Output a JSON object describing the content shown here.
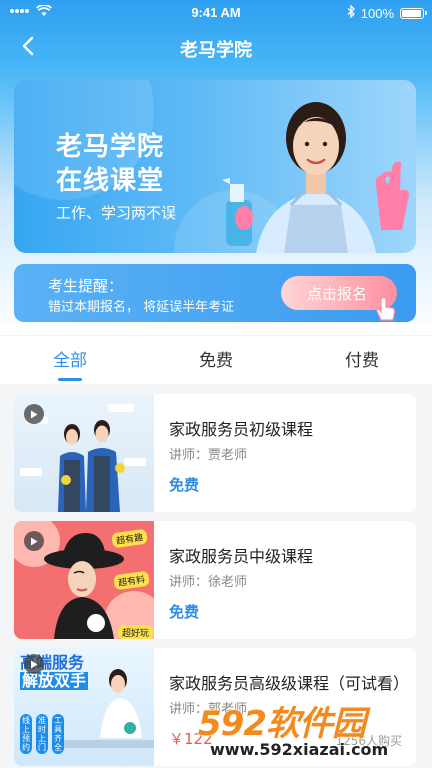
{
  "status_bar": {
    "time": "9:41 AM",
    "battery": "100%"
  },
  "nav": {
    "title": "老马学院"
  },
  "banner": {
    "title_line1": "老马学院",
    "title_line2": "在线课堂",
    "subtitle": "工作、学习两不误"
  },
  "reminder": {
    "title": "考生提醒：",
    "text": "错过本期报名， 将延误半年考证",
    "button": "点击报名"
  },
  "tabs": [
    {
      "label": "全部"
    },
    {
      "label": "免费"
    },
    {
      "label": "付费"
    }
  ],
  "active_tab": "全部",
  "courses": [
    {
      "title": "家政服务员初级课程",
      "teacher": "讲师：贾老师",
      "price": "免费"
    },
    {
      "title": "家政服务员中级课程",
      "teacher": "讲师：徐老师",
      "price": "免费"
    },
    {
      "title": "家政服务员高级级课程（可试看）",
      "teacher": "讲师：郭老师",
      "price": "￥122",
      "count": "1256人购买"
    }
  ],
  "thumb_texts": {
    "card2_bubble1": "超有趣",
    "card2_bubble2": "超有料",
    "card2_bubble3": "超好玩",
    "card3_title1": "高端服务",
    "card3_title2": "解放双手",
    "card3_tag1": "线上预约",
    "card3_tag2": "准时上门",
    "card3_tag3": "工具齐全"
  },
  "watermark": {
    "brand": "592软件园",
    "url": "www.592xiazai.com"
  },
  "colors": {
    "primary": "#2f8fe8",
    "price_red": "#ee5a4a",
    "header_blue": "#2f9ff0"
  }
}
